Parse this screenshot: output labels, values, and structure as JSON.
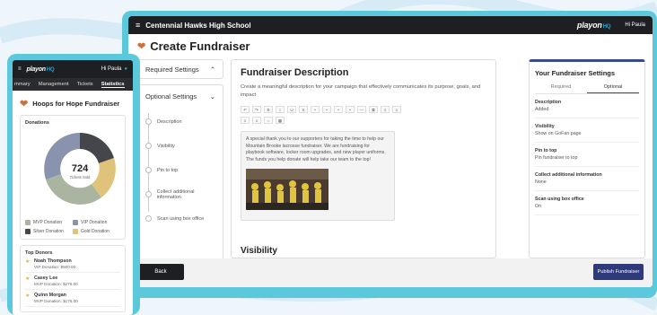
{
  "desktop": {
    "topbar": {
      "school": "Centennial Hawks High School",
      "logo": "playon",
      "logo_hq": "HQ",
      "greeting": "Hi Paula"
    },
    "page_title": "Create Fundraiser",
    "required_settings": "Required Settings",
    "optional_settings": {
      "label": "Optional Settings",
      "steps": [
        "Description",
        "Visibility",
        "Pin to top",
        "Collect additional information",
        "Scan using box office"
      ]
    },
    "main": {
      "heading": "Fundraiser Description",
      "helper": "Create a meaningful description for your campaign that effectively communicates its purpose, goals, and impact",
      "toolbar": [
        "↶",
        "↷",
        "B",
        "I",
        "U",
        "S",
        "•",
        "•",
        "•",
        "•",
        "—",
        "⧉",
        "≡",
        "≡",
        "≡",
        "≡",
        "⇔",
        "▦"
      ],
      "editor_text": "A special thank you to our supporters for taking the time to help our Mountain Brooke lacrosse fundraiser. We are fundraising for playbook software, locker room upgrades, and new player uniforms. The funds you help donate will help take our team to the top!",
      "next_section": "Visibility"
    },
    "summary": {
      "title": "Your Fundraiser Settings",
      "tabs": [
        "Required",
        "Optional"
      ],
      "active_tab": "Optional",
      "items": [
        {
          "key": "Description",
          "value": "Added"
        },
        {
          "key": "Visibility",
          "value": "Show on GoFan page"
        },
        {
          "key": "Pin to top",
          "value": "Pin fundraiser to top"
        },
        {
          "key": "Collect additional information",
          "value": "None"
        },
        {
          "key": "Scan using box office",
          "value": "On"
        }
      ]
    },
    "buttons": {
      "back": "Back",
      "publish": "Publish Fundraiser"
    }
  },
  "mobile": {
    "topbar": {
      "logo": "playon",
      "logo_hq": "HQ",
      "greeting": "Hi Paula"
    },
    "tabs": [
      "mmary",
      "Management",
      "Tickets",
      "Statistics"
    ],
    "active_tab": "Statistics",
    "fundraiser_title": "Hoops for Hope Fundraiser",
    "donations": {
      "heading": "Donations",
      "total": "724",
      "total_label": "Tickets Sold",
      "legend": [
        {
          "label": "MVP Donation",
          "color": "#a9b4a1"
        },
        {
          "label": "VIP Donation",
          "color": "#8a93ad"
        },
        {
          "label": "Silver Donation",
          "color": "#44464c"
        },
        {
          "label": "Gold Donation",
          "color": "#e0c37a"
        }
      ]
    },
    "top_donors": {
      "heading": "Top Donors",
      "items": [
        {
          "name": "Noah Thompson",
          "amount": "VIP Donation: $500.00"
        },
        {
          "name": "Casey Lee",
          "amount": "MVP Donation: $275.00"
        },
        {
          "name": "Quinn Morgan",
          "amount": "MVP Donation: $175.00"
        }
      ]
    }
  },
  "colors": {
    "accent": "#5cc8dc",
    "dark": "#1e1f22",
    "primary": "#2e3a7a"
  }
}
